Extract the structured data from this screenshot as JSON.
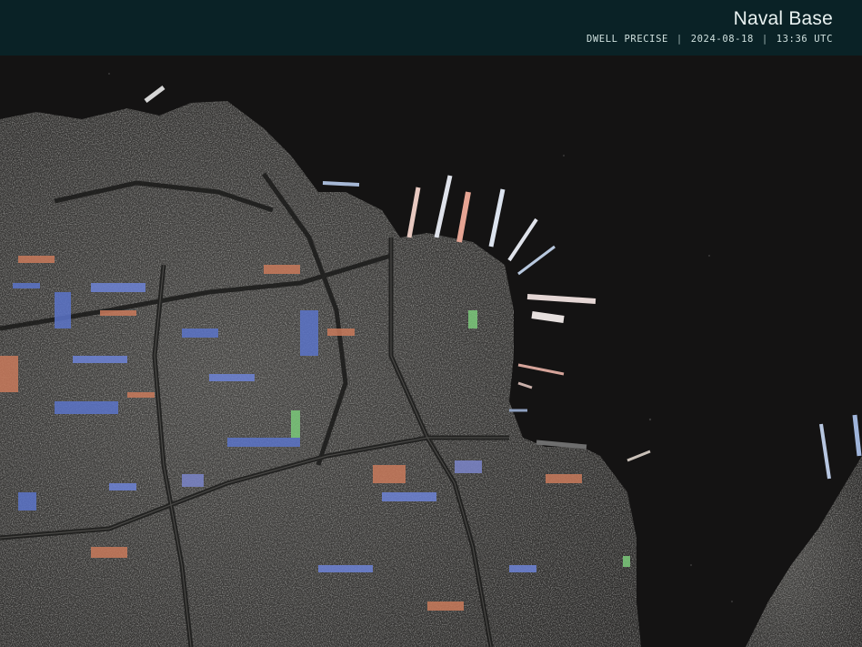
{
  "header": {
    "title": "Naval Base",
    "mode": "DWELL PRECISE",
    "date": "2024-08-18",
    "time": "13:36 UTC"
  },
  "colors": {
    "header_bg": "#0a2226",
    "water": "#141313",
    "land": "#3a3a38",
    "accent_blue": "#5b74c9",
    "accent_orange": "#c97a5b",
    "accent_green": "#7bc97a"
  }
}
